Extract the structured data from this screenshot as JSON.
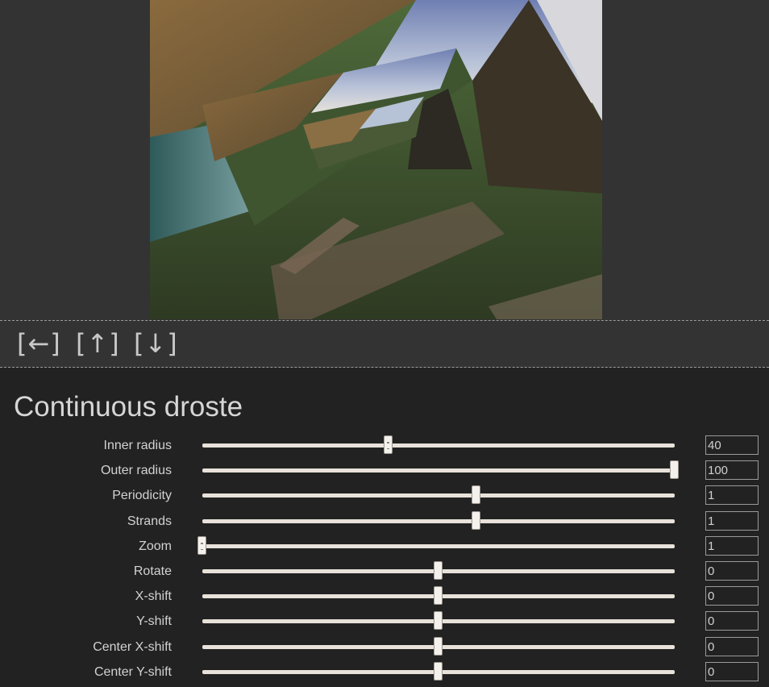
{
  "toolbar": {
    "back": {
      "label": "[←]",
      "icon": "left-arrow-icon"
    },
    "up": {
      "label": "[↑]",
      "icon": "up-arrow-icon"
    },
    "down": {
      "label": "[↓]",
      "icon": "down-arrow-icon"
    }
  },
  "panel": {
    "title": "Continuous droste",
    "controls": [
      {
        "label": "Inner radius",
        "value": "40",
        "fraction": 0.395
      },
      {
        "label": "Outer radius",
        "value": "100",
        "fraction": 1.0
      },
      {
        "label": "Periodicity",
        "value": "1",
        "fraction": 0.58
      },
      {
        "label": "Strands",
        "value": "1",
        "fraction": 0.58
      },
      {
        "label": "Zoom",
        "value": "1",
        "fraction": 0.0
      },
      {
        "label": "Rotate",
        "value": "0",
        "fraction": 0.5
      },
      {
        "label": "X-shift",
        "value": "0",
        "fraction": 0.5
      },
      {
        "label": "Y-shift",
        "value": "0",
        "fraction": 0.5
      },
      {
        "label": "Center X-shift",
        "value": "0",
        "fraction": 0.5
      },
      {
        "label": "Center Y-shift",
        "value": "0",
        "fraction": 0.5
      }
    ]
  },
  "colors": {
    "background": "#222222",
    "top_area": "#333333",
    "slider_track": "#e8e2da",
    "text": "#d2d2d2"
  }
}
